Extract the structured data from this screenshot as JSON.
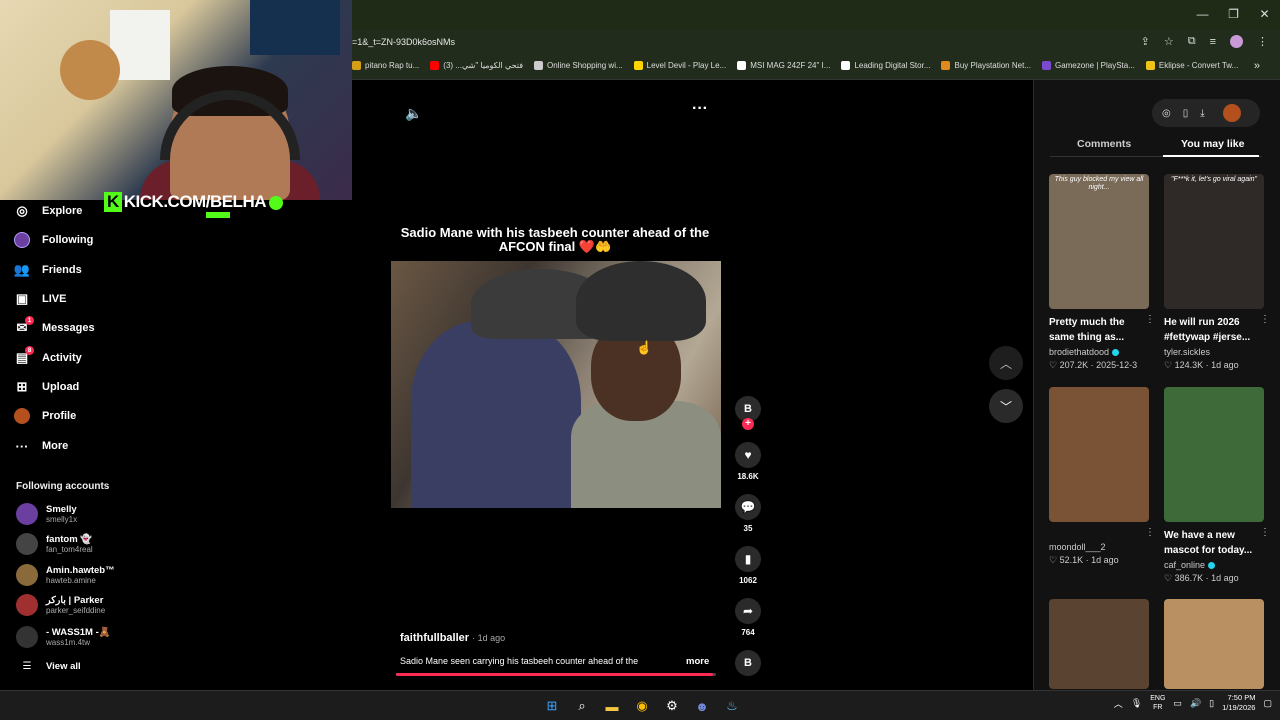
{
  "browser": {
    "url": "=1&_t=ZN-93D0k6osNMs",
    "bookmarks": [
      {
        "label": "pitano Rap tu...",
        "color": "#d4a017"
      },
      {
        "label": "فتحي الكوميا \"شي... (3)",
        "color": "#ff0000"
      },
      {
        "label": "Online Shopping wi...",
        "color": "#cccccc"
      },
      {
        "label": "Level Devil - Play Le...",
        "color": "#ffd400"
      },
      {
        "label": "MSI MAG 242F 24\" I...",
        "color": "#ffffff"
      },
      {
        "label": "Leading Digital Stor...",
        "color": "#ffffff"
      },
      {
        "label": "Buy Playstation Net...",
        "color": "#e08a1e"
      },
      {
        "label": "Gamezone | PlaySta...",
        "color": "#7a4bd1"
      },
      {
        "label": "Eklipse - Convert Tw...",
        "color": "#f0c419"
      }
    ],
    "bookmarks_more": "»",
    "window_controls": [
      "—",
      "❐",
      "✕"
    ]
  },
  "overlay": {
    "kick_text": "KICK.COM/BELHA",
    "kick_letter": "K"
  },
  "sidebar": {
    "items": [
      {
        "label": "Explore",
        "icon": "compass-icon",
        "glyph": "◎"
      },
      {
        "label": "Following",
        "icon": "avatar-icon",
        "glyph": "●"
      },
      {
        "label": "Friends",
        "icon": "friends-icon",
        "glyph": "👥"
      },
      {
        "label": "LIVE",
        "icon": "live-icon",
        "glyph": "▣"
      },
      {
        "label": "Messages",
        "icon": "messages-icon",
        "glyph": "✉",
        "badge": "1"
      },
      {
        "label": "Activity",
        "icon": "activity-icon",
        "glyph": "▤",
        "badge": "8"
      },
      {
        "label": "Upload",
        "icon": "upload-icon",
        "glyph": "⊞"
      },
      {
        "label": "Profile",
        "icon": "profile-icon",
        "glyph": "●"
      },
      {
        "label": "More",
        "icon": "more-icon",
        "glyph": "···"
      }
    ],
    "following_title": "Following accounts",
    "accounts": [
      {
        "name": "Smelly",
        "handle": "smelly1x",
        "color": "#6a3fa0"
      },
      {
        "name": "fantom 👻",
        "handle": "fan_tom4real",
        "color": "#444444"
      },
      {
        "name": "Amin.hawteb™",
        "handle": "hawteb.amine",
        "color": "#8a6a3a"
      },
      {
        "name": "باركر | Parker",
        "handle": "parker_seifddine",
        "color": "#a03030"
      },
      {
        "name": "- WASS1M -🧸",
        "handle": "wass1m.4tw",
        "color": "#333333"
      }
    ],
    "view_all": "View all"
  },
  "player": {
    "title": "Sadio Mane with his tasbeeh counter ahead of the AFCON final ❤️🤲",
    "author": "faithfullballer",
    "posted": "· 1d ago",
    "caption": "Sadio Mane seen carrying his tasbeeh counter ahead of the",
    "more": "more",
    "progress": 0.99,
    "likes": "18.6K",
    "comments": "35",
    "saves": "1062",
    "shares": "764",
    "author_initial": "B"
  },
  "right_panel": {
    "tabs": [
      "Comments",
      "You may like"
    ],
    "active_tab": "You may like",
    "cards": [
      {
        "title": "Pretty much the same thing as...",
        "user": "brodiethatdood",
        "verified": true,
        "likes": "207.2K",
        "date": "2025-12-3",
        "overlay": "This guy blocked my view all night...",
        "bg": "#7a6a58"
      },
      {
        "title": "He will run 2026 #fettywap #jerse...",
        "user": "tyler.sickles",
        "verified": false,
        "likes": "124.3K",
        "date": "1d ago",
        "overlay": "\"F***k it, let's go viral again\"",
        "bg": "#2f2a28"
      },
      {
        "title": "",
        "user": "moondoll___2",
        "verified": false,
        "likes": "52.1K",
        "date": "1d ago",
        "overlay": "",
        "bg": "#7a5236"
      },
      {
        "title": "We have a new mascot for today...",
        "user": "caf_online",
        "verified": true,
        "likes": "386.7K",
        "date": "1d ago",
        "overlay": "",
        "bg": "#3e6a3a"
      },
      {
        "title": "",
        "user": "",
        "verified": false,
        "likes": "",
        "date": "",
        "overlay": "",
        "bg": "#5a4330"
      },
      {
        "title": "",
        "user": "",
        "verified": false,
        "likes": "",
        "date": "",
        "overlay": "",
        "bg": "#b89062"
      }
    ]
  },
  "taskbar": {
    "lang_top": "ENG",
    "lang_bottom": "FR",
    "time": "7:50 PM",
    "date": "1/19/2026"
  },
  "colors": {
    "accent": "#fe2c55",
    "kick": "#53fc18"
  }
}
